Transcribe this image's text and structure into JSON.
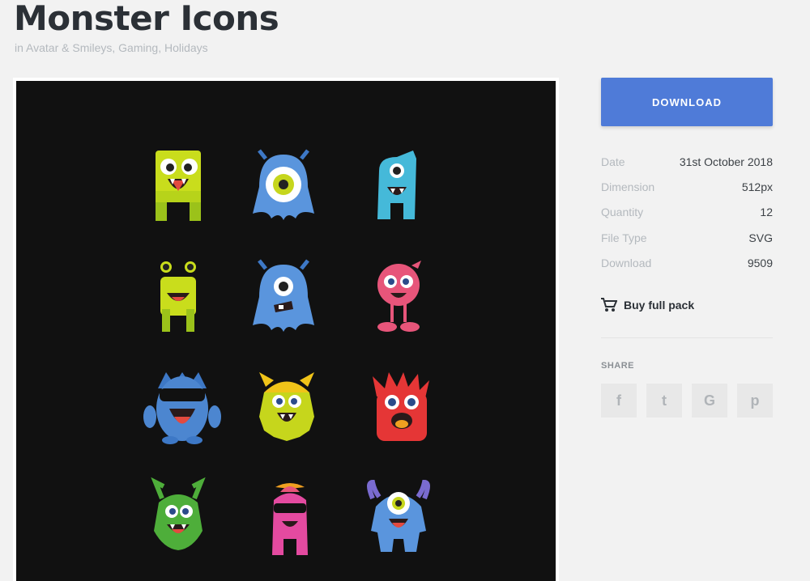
{
  "header": {
    "title": "Monster Icons",
    "categories_prefix": "in",
    "categories": [
      "Avatar & Smileys",
      "Gaming",
      "Holidays"
    ]
  },
  "sidebar": {
    "download_label": "DOWNLOAD",
    "meta": [
      {
        "key": "Date",
        "value": "31st October 2018"
      },
      {
        "key": "Dimension",
        "value": "512px"
      },
      {
        "key": "Quantity",
        "value": "12"
      },
      {
        "key": "File Type",
        "value": "SVG"
      },
      {
        "key": "Download",
        "value": "9509"
      }
    ],
    "buy_label": "Buy full pack",
    "share_label": "SHARE",
    "share_buttons": [
      {
        "icon": "facebook-icon",
        "glyph": "f"
      },
      {
        "icon": "twitter-icon",
        "glyph": "t"
      },
      {
        "icon": "google-icon",
        "glyph": "G"
      },
      {
        "icon": "pinterest-icon",
        "glyph": "p"
      }
    ]
  },
  "colors": {
    "accent": "#4f7bd8",
    "preview_bg": "#111111"
  }
}
